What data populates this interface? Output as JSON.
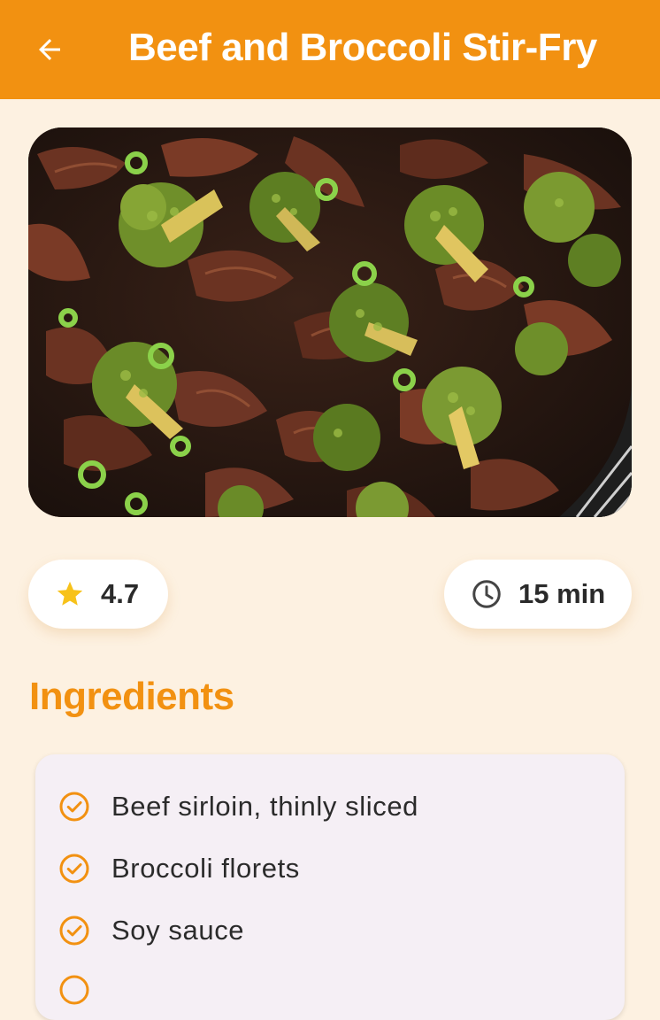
{
  "appbar": {
    "back_icon": "arrow-left-icon",
    "title": "Beef and Broccoli Stir-Fry",
    "background": "#F29111"
  },
  "hero": {
    "image": "beef-and-broccoli-stir-fry-photo"
  },
  "stats": {
    "rating_icon": "star-icon",
    "rating": "4.7",
    "time_icon": "clock-icon",
    "time": "15 min"
  },
  "ingredients": {
    "title": "Ingredients",
    "item_icon": "check-circle-icon",
    "items": [
      "Beef sirloin, thinly sliced",
      "Broccoli florets",
      "Soy sauce"
    ]
  },
  "colors": {
    "accent": "#F29111",
    "background": "#FDF1E1",
    "card": "#F5EFF5",
    "star": "#F7C21A"
  }
}
